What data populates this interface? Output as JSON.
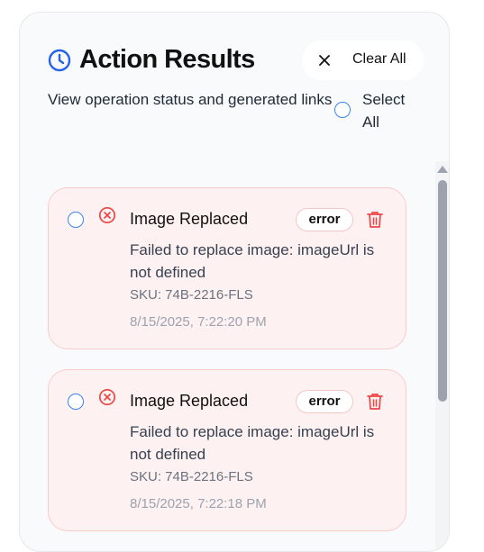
{
  "header": {
    "title": "Action Results",
    "subtitle": "View operation status and generated links",
    "clear_all_label": "Clear All",
    "select_all_label": "Select All",
    "icons": {
      "header": "clock-icon",
      "clear": "close-icon"
    }
  },
  "results": [
    {
      "title": "Image Replaced",
      "status": "error",
      "message": "Failed to replace image: imageUrl is not defined",
      "sku": "SKU: 74B-2216-FLS",
      "timestamp": "8/15/2025, 7:22:20 PM"
    },
    {
      "title": "Image Replaced",
      "status": "error",
      "message": "Failed to replace image: imageUrl is not defined",
      "sku": "SKU: 74B-2216-FLS",
      "timestamp": "8/15/2025, 7:22:18 PM"
    }
  ],
  "colors": {
    "accent": "#3b82f6",
    "error": "#ef4444",
    "card_bg": "#fef1f1",
    "card_border": "#fbcaca"
  }
}
